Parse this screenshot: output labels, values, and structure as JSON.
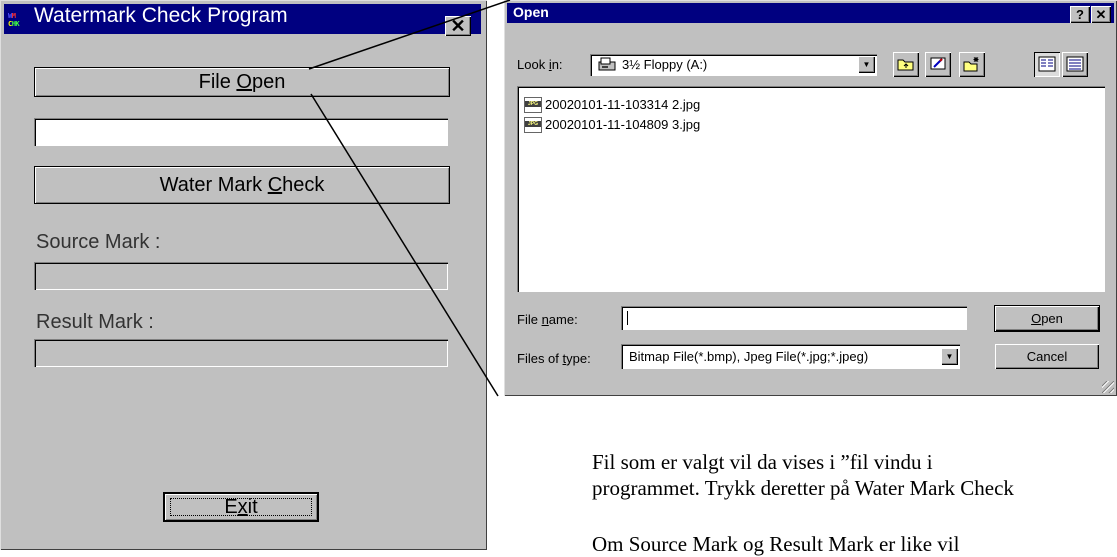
{
  "watermark_app": {
    "title": "Watermark Check Program",
    "icon_row1": {
      "a": "W",
      "b": "M"
    },
    "icon_row2": {
      "a": "C",
      "b": "HK"
    },
    "close_glyph": "✕",
    "file_open": {
      "pre": "File ",
      "ul": "O",
      "post": "pen"
    },
    "file_path_value": "",
    "watermark_check": {
      "pre": "Water Mark ",
      "ul": "C",
      "post": "heck"
    },
    "source_mark_label": "Source Mark :",
    "source_mark_value": "",
    "result_mark_label": "Result Mark  :",
    "result_mark_value": "",
    "exit": {
      "pre": "E",
      "ul": "x",
      "post": "it"
    }
  },
  "open_dialog": {
    "title": "Open",
    "help_glyph": "?",
    "close_glyph": "✕",
    "look_in": {
      "pre": "Look ",
      "ul": "i",
      "post": "n:"
    },
    "look_in_value": "3½ Floppy (A:)",
    "files": [
      {
        "name": "20020101-11-103314 2.jpg",
        "icon_text": "JPG"
      },
      {
        "name": "20020101-11-104809 3.jpg",
        "icon_text": "JPG"
      }
    ],
    "file_name": {
      "pre": "File ",
      "ul": "n",
      "post": "ame:"
    },
    "file_name_value": "",
    "files_of_type": {
      "pre": "Files of ",
      "ul": "t",
      "post": "ype:"
    },
    "files_of_type_value": "Bitmap File(*.bmp), Jpeg File(*.jpg;*.jpeg)",
    "open_button": {
      "pre": "",
      "ul": "O",
      "post": "pen"
    },
    "cancel_button": "Cancel",
    "dropdown_glyph": "▼"
  },
  "caption": {
    "line1": "Fil som er valgt vil da vises i ”fil vindu i",
    "line2": "programmet. Trykk deretter på Water Mark Check",
    "line3": "Om Source Mark og Result Mark er like vil"
  }
}
